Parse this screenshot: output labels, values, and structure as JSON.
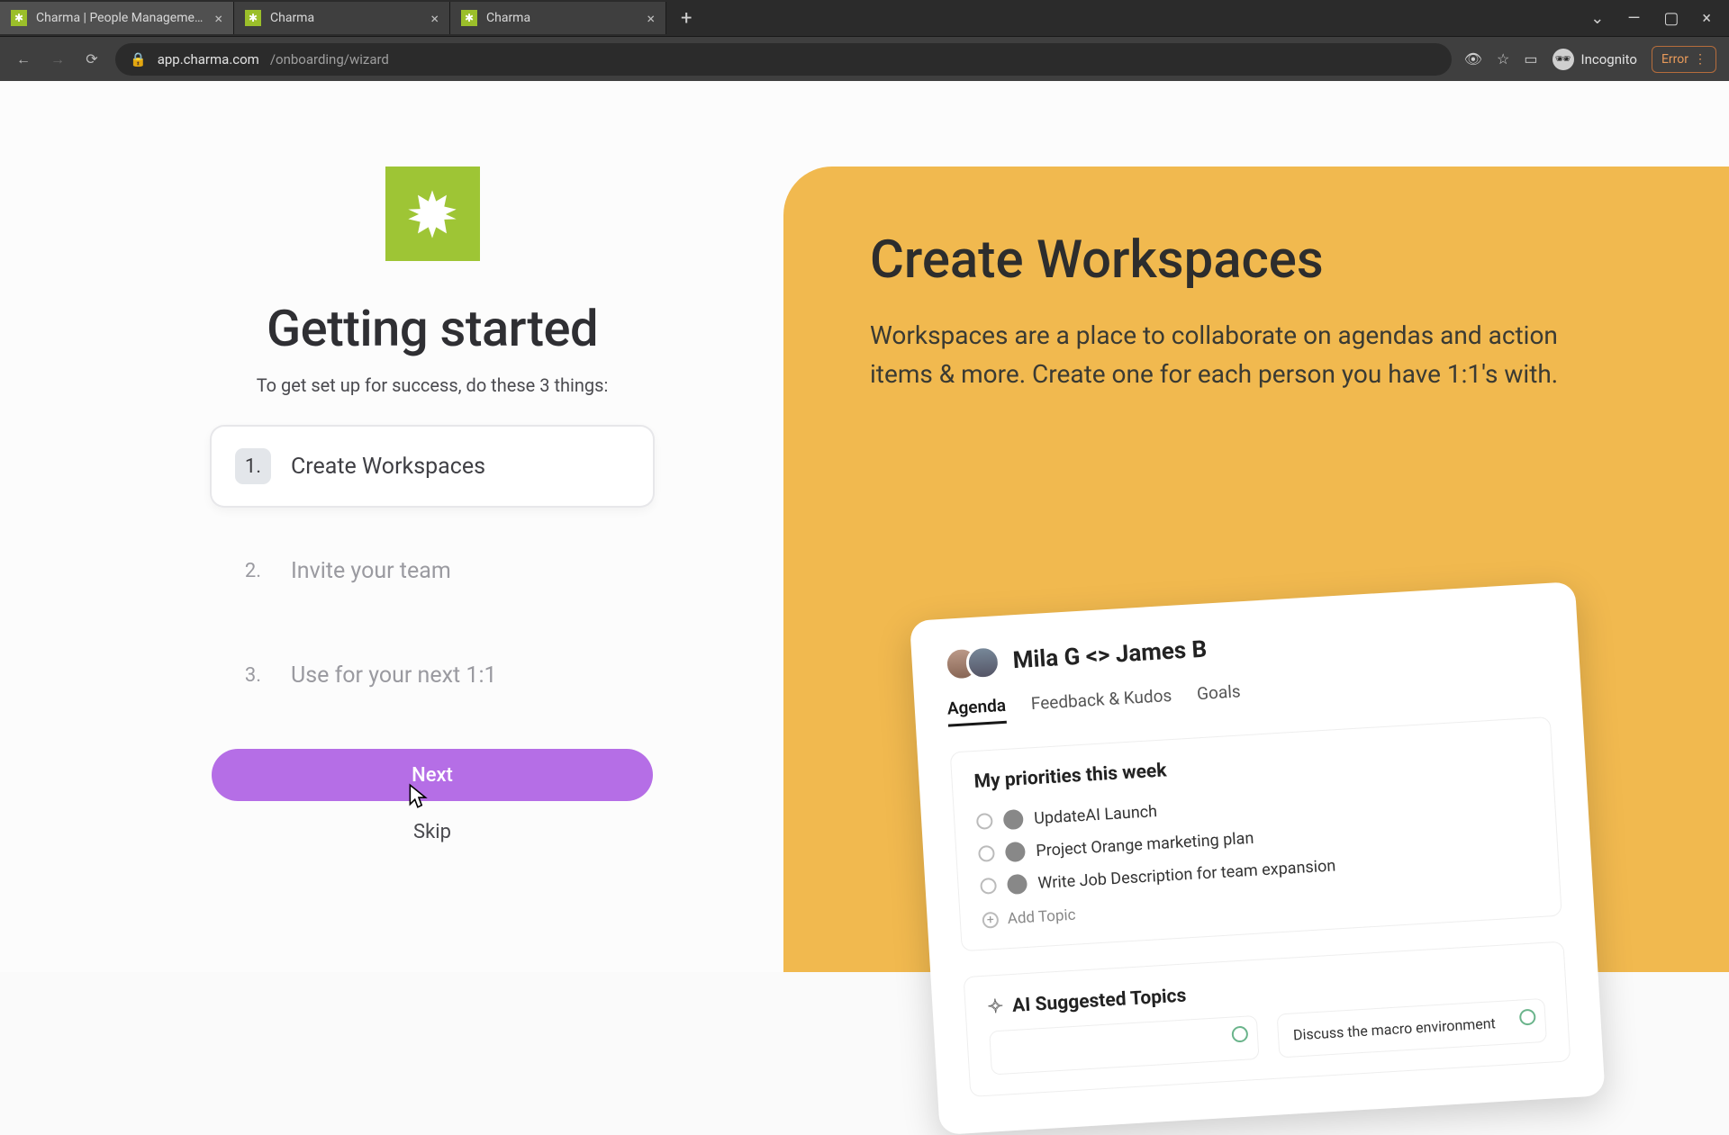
{
  "browser": {
    "tabs": [
      {
        "title": "Charma | People Management S"
      },
      {
        "title": "Charma"
      },
      {
        "title": "Charma"
      }
    ],
    "url_host": "app.charma.com",
    "url_path": "/onboarding/wizard",
    "incognito_label": "Incognito",
    "error_label": "Error"
  },
  "onboarding": {
    "heading": "Getting started",
    "subheading": "To get set up for success, do these 3 things:",
    "steps": [
      {
        "num": "1.",
        "label": "Create Workspaces"
      },
      {
        "num": "2.",
        "label": "Invite your team"
      },
      {
        "num": "3.",
        "label": "Use for your next 1:1"
      }
    ],
    "next_label": "Next",
    "skip_label": "Skip"
  },
  "panel": {
    "title": "Create Workspaces",
    "description": "Workspaces are a place to collaborate on agendas and action items & more. Create one for each person you have 1:1's with."
  },
  "mock": {
    "title": "Mila G <> James B",
    "tabs": {
      "agenda": "Agenda",
      "feedback": "Feedback & Kudos",
      "goals": "Goals"
    },
    "section_title": "My priorities this week",
    "items": [
      "UpdateAI Launch",
      "Project Orange marketing plan",
      "Write Job Description for team expansion"
    ],
    "add_topic": "Add Topic",
    "ai_title": "AI Suggested Topics",
    "suggestions": [
      "",
      "Discuss the macro environment"
    ]
  }
}
